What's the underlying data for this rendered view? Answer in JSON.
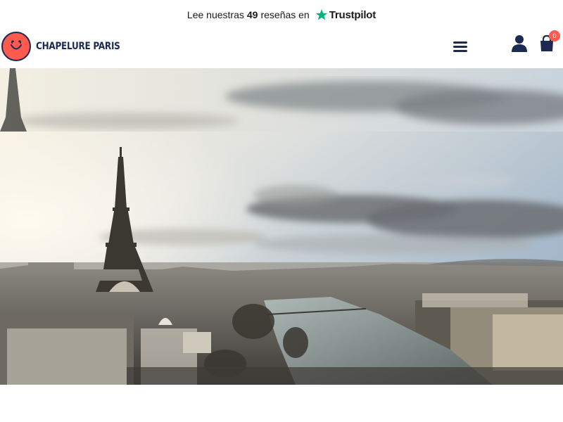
{
  "topbar": {
    "prefix": "Lee nuestras",
    "count": "49",
    "suffix": "reseñas en",
    "brand": "Trustpilot"
  },
  "header": {
    "logo_text": "CHAPELURE PARIS",
    "cart_count": "0"
  },
  "icons": {
    "trustpilot_star": "star-icon",
    "menu": "hamburger-menu-icon",
    "user": "user-icon",
    "cart": "shopping-bag-icon"
  },
  "colors": {
    "brand_navy": "#1c2a52",
    "brand_coral": "#ff5a4e",
    "trustpilot_green": "#00b67a"
  }
}
